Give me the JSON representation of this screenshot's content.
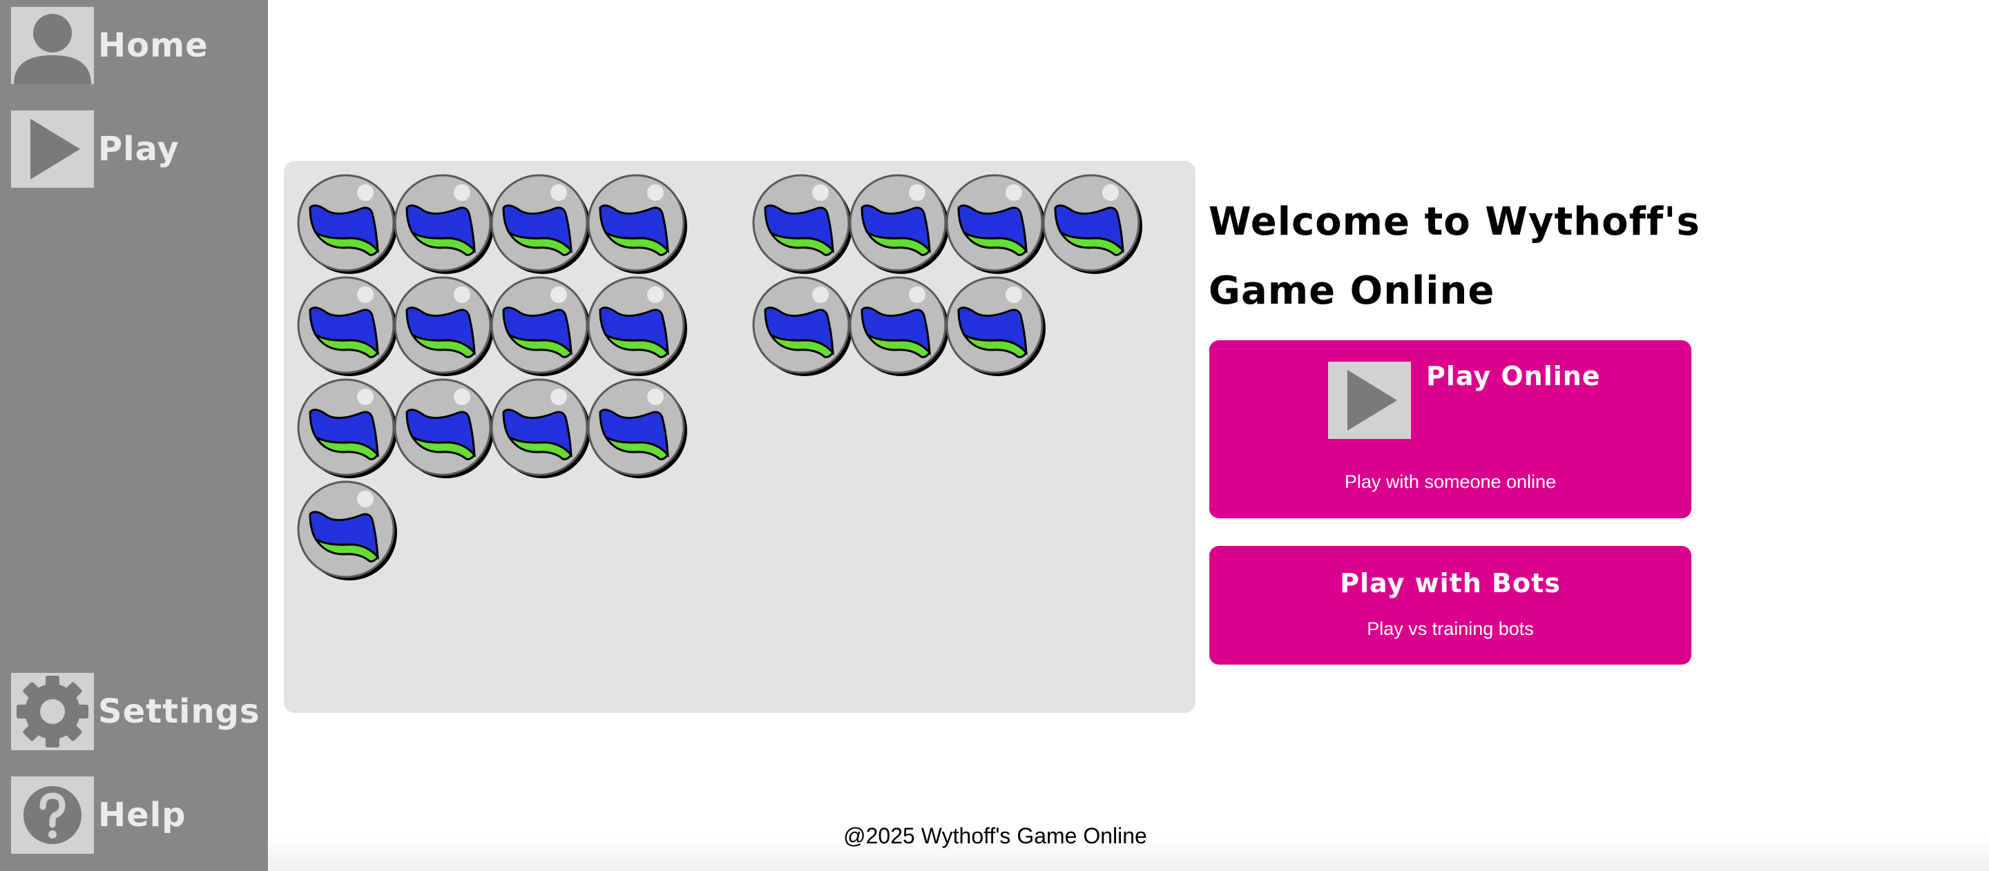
{
  "sidebar": {
    "items": [
      {
        "label": "Home",
        "icon": "user-icon"
      },
      {
        "label": "Play",
        "icon": "play-icon"
      },
      {
        "label": "Settings",
        "icon": "gear-icon"
      },
      {
        "label": "Help",
        "icon": "help-icon"
      }
    ]
  },
  "board": {
    "piles": [
      {
        "count": 13,
        "per_row": 4
      },
      {
        "count": 7,
        "per_row": 4
      }
    ],
    "token_icon": "marble-token-icon",
    "colors": {
      "token_blue": "#2233dd",
      "token_green": "#66dd33",
      "token_body": "#bdbdbd"
    }
  },
  "main": {
    "welcome_title": "Welcome to Wythoff's Game Online",
    "play_online": {
      "title": "Play Online",
      "subtitle": "Play with someone online",
      "icon": "play-icon"
    },
    "play_bots": {
      "title": "Play with Bots",
      "subtitle": "Play vs training bots"
    }
  },
  "footer": {
    "text": "@2025 Wythoff's Game Online"
  },
  "colors": {
    "sidebar": "#878787",
    "accent": "#db008c",
    "board_bg": "#e3e3e3",
    "icon_box": "#d2d2d2",
    "icon_fg": "#7a7a7a"
  }
}
